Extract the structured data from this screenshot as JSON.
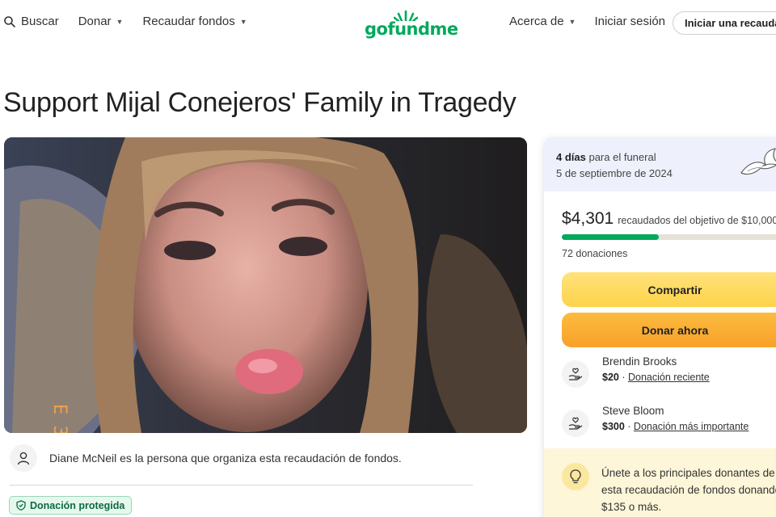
{
  "header": {
    "search_label": "Buscar",
    "donate_label": "Donar",
    "fundraise_label": "Recaudar fondos",
    "logo_text": "gofundme",
    "about_label": "Acerca de",
    "login_label": "Iniciar sesión",
    "start_label": "Iniciar una recaudación"
  },
  "page": {
    "title": "Support Mijal Conejeros' Family in Tragedy"
  },
  "organizer": {
    "text": "Diane McNeil es la persona que organiza esta recaudación de fondos."
  },
  "badge": {
    "label": "Donación protegida"
  },
  "card": {
    "days_bold": "4 días",
    "days_rest": " para el funeral",
    "date": "5 de septiembre de 2024",
    "raised_amount": "$4,301",
    "raised_goal": "recaudados del objetivo de $10,000",
    "progress_fraction": 0.43,
    "donations_count": "72 donaciones",
    "share_label": "Compartir",
    "donate_now_label": "Donar ahora",
    "donors": [
      {
        "name": "Brendin Brooks",
        "amount": "$20",
        "sep": " · ",
        "tag": "Donación reciente"
      },
      {
        "name": "Steve Bloom",
        "amount": "$300",
        "sep": " · ",
        "tag": "Donación más importante"
      }
    ],
    "tip_text": "Únete a los principales donantes de esta recaudación de fondos donando $135 o más."
  },
  "colors": {
    "brand_green": "#02a95c",
    "share_yellow": "#fed34a",
    "donate_orange": "#f8a02a",
    "card_top_bg": "#eef1fb",
    "tip_bg": "#fdf6d8"
  }
}
